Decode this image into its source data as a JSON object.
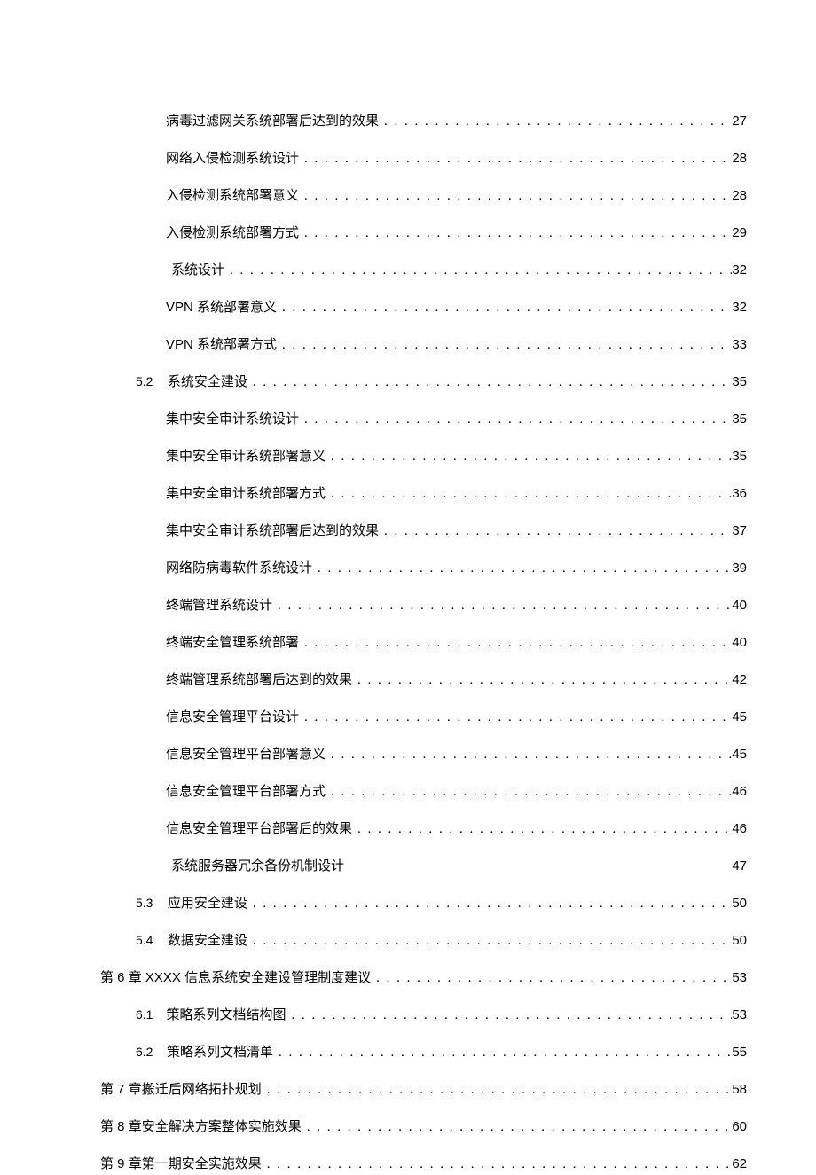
{
  "toc": [
    {
      "indent": "indent-2",
      "num": "",
      "label": "病毒过滤网关系统部署后达到的效果",
      "page": "27",
      "leader": true
    },
    {
      "indent": "indent-2",
      "num": "",
      "label": "网络入侵检测系统设计",
      "page": "28",
      "leader": true
    },
    {
      "indent": "indent-2",
      "num": "",
      "label": "入侵检测系统部署意义",
      "page": "28",
      "leader": true
    },
    {
      "indent": "indent-2",
      "num": "",
      "label": "入侵检测系统部署方式",
      "page": "29",
      "leader": true
    },
    {
      "indent": "indent-2b",
      "num": "",
      "label": "系统设计",
      "page": "32",
      "leader": true
    },
    {
      "indent": "indent-2",
      "num": "",
      "label": "VPN 系统部署意义",
      "page": "32",
      "leader": true,
      "latin": true
    },
    {
      "indent": "indent-2",
      "num": "",
      "label": "VPN 系统部署方式",
      "page": "33",
      "leader": true,
      "latin": true
    },
    {
      "indent": "indent-1",
      "num": "5.2",
      "label": "系统安全建设",
      "page": "35",
      "leader": true
    },
    {
      "indent": "indent-2",
      "num": "",
      "label": "集中安全审计系统设计",
      "page": "35",
      "leader": true
    },
    {
      "indent": "indent-2",
      "num": "",
      "label": "集中安全审计系统部署意义",
      "page": "35",
      "leader": true
    },
    {
      "indent": "indent-2",
      "num": "",
      "label": "集中安全审计系统部署方式",
      "page": "36",
      "leader": true
    },
    {
      "indent": "indent-2",
      "num": "",
      "label": "集中安全审计系统部署后达到的效果",
      "page": "37",
      "leader": true
    },
    {
      "indent": "indent-2",
      "num": "",
      "label": "网络防病毒软件系统设计",
      "page": "39",
      "leader": true
    },
    {
      "indent": "indent-2",
      "num": "",
      "label": "终端管理系统设计",
      "page": "40",
      "leader": true
    },
    {
      "indent": "indent-2",
      "num": "",
      "label": "终端安全管理系统部署",
      "page": "40",
      "leader": true
    },
    {
      "indent": "indent-2",
      "num": "",
      "label": "终端管理系统部署后达到的效果",
      "page": "42",
      "leader": true
    },
    {
      "indent": "indent-2",
      "num": "",
      "label": "信息安全管理平台设计",
      "page": "45",
      "leader": true
    },
    {
      "indent": "indent-2",
      "num": "",
      "label": "信息安全管理平台部署意义",
      "page": "45",
      "leader": true
    },
    {
      "indent": "indent-2",
      "num": "",
      "label": "信息安全管理平台部署方式",
      "page": "46",
      "leader": true
    },
    {
      "indent": "indent-2",
      "num": "",
      "label": "信息安全管理平台部署后的效果",
      "page": "46",
      "leader": true
    },
    {
      "indent": "indent-2b",
      "num": "",
      "label": "系统服务器冗余备份机制设计",
      "page": "47",
      "leader": false
    },
    {
      "indent": "indent-1",
      "num": "5.3",
      "label": "应用安全建设",
      "page": "50",
      "leader": true
    },
    {
      "indent": "indent-1",
      "num": "5.4",
      "label": "数据安全建设",
      "page": "50",
      "leader": true
    },
    {
      "indent": "indent-0",
      "num": "",
      "label": "第 6 章 XXXX 信息系统安全建设管理制度建议",
      "page": "53",
      "leader": true,
      "latin": true
    },
    {
      "indent": "indent-1",
      "num": "6.1",
      "label": "策略系列文档结构图",
      "page": "53",
      "leader": true
    },
    {
      "indent": "indent-1",
      "num": "6.2",
      "label": "策略系列文档清单",
      "page": "55",
      "leader": true
    },
    {
      "indent": "indent-0",
      "num": "",
      "label": "第 7 章搬迁后网络拓扑规划",
      "page": "58",
      "leader": true,
      "latin": true
    },
    {
      "indent": "indent-0",
      "num": "",
      "label": "第 8 章安全解决方案整体实施效果",
      "page": "60",
      "leader": true,
      "latin": true
    },
    {
      "indent": "indent-0",
      "num": "",
      "label": "第 9 章第一期安全实施效果",
      "page": "62",
      "leader": true,
      "latin": true
    }
  ]
}
